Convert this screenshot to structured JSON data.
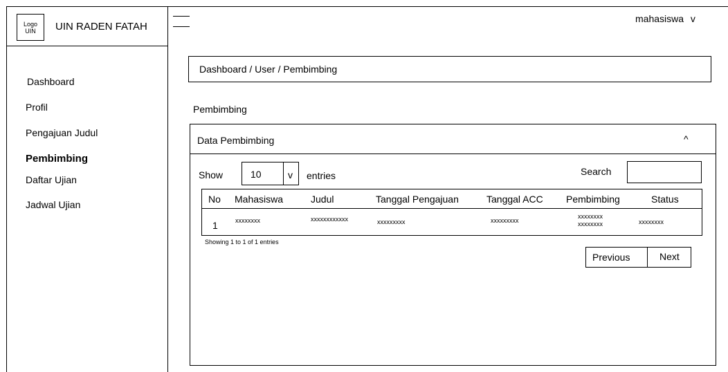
{
  "brand": {
    "logo_text": "Logo UIN",
    "logo_line1": "Logo",
    "logo_line2": "UIN",
    "name": "UIN RADEN FATAH"
  },
  "sidebar": {
    "items": [
      {
        "label": "Dashboard"
      },
      {
        "label": "Profil"
      },
      {
        "label": "Pengajuan Judul"
      },
      {
        "label": "Pembimbing",
        "active": true
      },
      {
        "label": "Daftar Ujian"
      },
      {
        "label": "Jadwal Ujian"
      }
    ]
  },
  "header": {
    "menu_icon": "hamburger-icon",
    "user": "mahasiswa",
    "user_chevron": "v"
  },
  "breadcrumb": "Dashboard / User / Pembimbing",
  "page_title": "Pembimbing",
  "card": {
    "title": "Data Pembimbing",
    "collapse_icon": "^",
    "show_label": "Show",
    "entries_value": "10",
    "entries_chevron": "v",
    "entries_label": "entries",
    "search_label": "Search",
    "search_value": ""
  },
  "table": {
    "columns": [
      "No",
      "Mahasiswa",
      "Judul",
      "Tanggal Pengajuan",
      "Tanggal ACC",
      "Pembimbing",
      "Status"
    ],
    "rows": [
      {
        "no": "1",
        "mahasiswa": "xxxxxxxx",
        "judul": "xxxxxxxxxxxx",
        "tanggal_pengajuan": "xxxxxxxxx",
        "tanggal_acc": "xxxxxxxxx",
        "pembimbing_1": "xxxxxxxx",
        "pembimbing_2": "xxxxxxxx",
        "status": "xxxxxxxx"
      }
    ]
  },
  "info": "Showing 1 to 1 of 1 entries",
  "pagination": {
    "previous": "Previous",
    "next": "Next"
  }
}
